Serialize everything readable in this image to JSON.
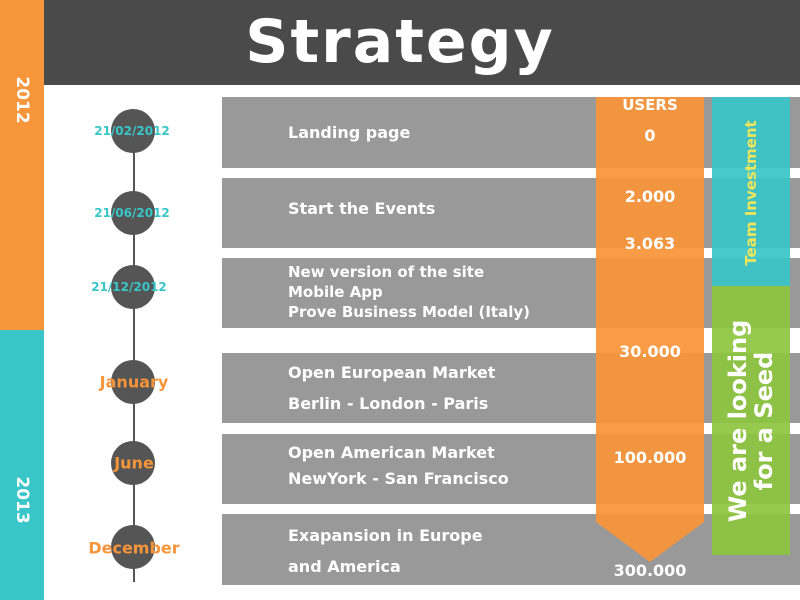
{
  "title": "Strategy",
  "years": [
    "2012",
    "2013"
  ],
  "milestones": [
    {
      "date": "21/02/2012",
      "text": [
        "Landing page"
      ]
    },
    {
      "date": "21/06/2012",
      "text": [
        "Start the Events"
      ]
    },
    {
      "date": "21/12/2012",
      "text": [
        "New version of the site",
        "Mobile App",
        "Prove Business Model (Italy)"
      ]
    },
    {
      "date": "January",
      "text": [
        "Open European Market",
        "Berlin - London - Paris"
      ]
    },
    {
      "date": "June",
      "text": [
        "Open American Market",
        "NewYork - San Francisco"
      ]
    },
    {
      "date": "December",
      "text": [
        "Exapansion in Europe",
        "and America"
      ]
    }
  ],
  "users": {
    "title": "USERS",
    "values": [
      "0",
      "2.000",
      "3.063",
      "30.000",
      "100.000",
      "300.000"
    ]
  },
  "team_investment": "Team Investment",
  "seed": [
    "We are looking",
    "for a Seed"
  ],
  "colors": {
    "orange": "#f7953a",
    "teal": "#38c6c8",
    "green": "#8dc63f",
    "dark_gray": "#4a4a4a",
    "gray": "#999999"
  }
}
